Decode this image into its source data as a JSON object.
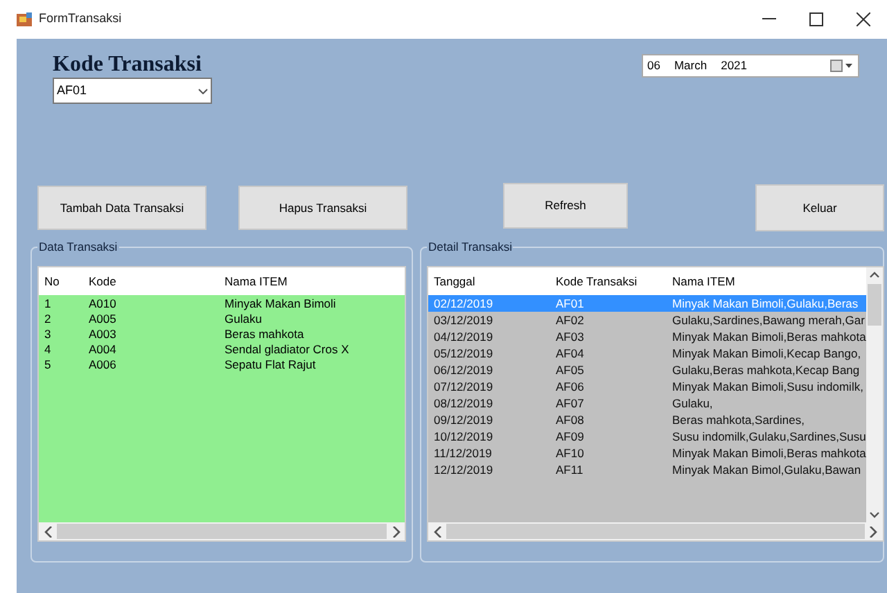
{
  "window": {
    "title": "FormTransaksi"
  },
  "kode_transaksi": {
    "label": "Kode Transaksi",
    "value": "AF01"
  },
  "date_picker": {
    "day": "06",
    "month": "March",
    "year": "2021"
  },
  "buttons": [
    {
      "label": "Tambah Data Transaksi"
    },
    {
      "label": "Hapus Transaksi"
    },
    {
      "label": "Refresh"
    },
    {
      "label": "Keluar"
    }
  ],
  "data_transaksi": {
    "title": "Data Transaksi",
    "columns": [
      "No",
      "Kode",
      "Nama ITEM"
    ],
    "rows": [
      {
        "cells": [
          "1",
          "A010",
          "Minyak Makan Bimoli"
        ]
      },
      {
        "cells": [
          "2",
          "A005",
          "Gulaku"
        ]
      },
      {
        "cells": [
          "3",
          "A003",
          "Beras mahkota"
        ]
      },
      {
        "cells": [
          "4",
          "A004",
          "Sendal gladiator Cros X"
        ]
      },
      {
        "cells": [
          "5",
          "A006",
          "Sepatu Flat Rajut"
        ]
      }
    ]
  },
  "detail_transaksi": {
    "title": "Detail Transaksi",
    "columns": [
      "Tanggal",
      "Kode Transaksi",
      "Nama ITEM"
    ],
    "rows": [
      {
        "selected": true,
        "cells": [
          "02/12/2019",
          "AF01",
          "Minyak Makan Bimoli,Gulaku,Beras"
        ]
      },
      {
        "selected": false,
        "cells": [
          "03/12/2019",
          "AF02",
          "Gulaku,Sardines,Bawang merah,Gar"
        ]
      },
      {
        "selected": false,
        "cells": [
          "04/12/2019",
          "AF03",
          "Minyak Makan Bimoli,Beras mahkota"
        ]
      },
      {
        "selected": false,
        "cells": [
          "05/12/2019",
          "AF04",
          "Minyak Makan Bimoli,Kecap Bango,"
        ]
      },
      {
        "selected": false,
        "cells": [
          "06/12/2019",
          "AF05",
          "Gulaku,Beras mahkota,Kecap Bang"
        ]
      },
      {
        "selected": false,
        "cells": [
          "07/12/2019",
          "AF06",
          "Minyak Makan Bimoli,Susu indomilk,"
        ]
      },
      {
        "selected": false,
        "cells": [
          "08/12/2019",
          "AF07",
          "Gulaku,"
        ]
      },
      {
        "selected": false,
        "cells": [
          "09/12/2019",
          "AF08",
          "Beras mahkota,Sardines,"
        ]
      },
      {
        "selected": false,
        "cells": [
          "10/12/2019",
          "AF09",
          "Susu indomilk,Gulaku,Sardines,Susu"
        ]
      },
      {
        "selected": false,
        "cells": [
          "11/12/2019",
          "AF10",
          "Minyak Makan Bimoli,Beras mahkota"
        ]
      },
      {
        "selected": false,
        "cells": [
          "12/12/2019",
          "AF11",
          "Minyak Makan Bimol,Gulaku,Bawan"
        ]
      }
    ]
  }
}
